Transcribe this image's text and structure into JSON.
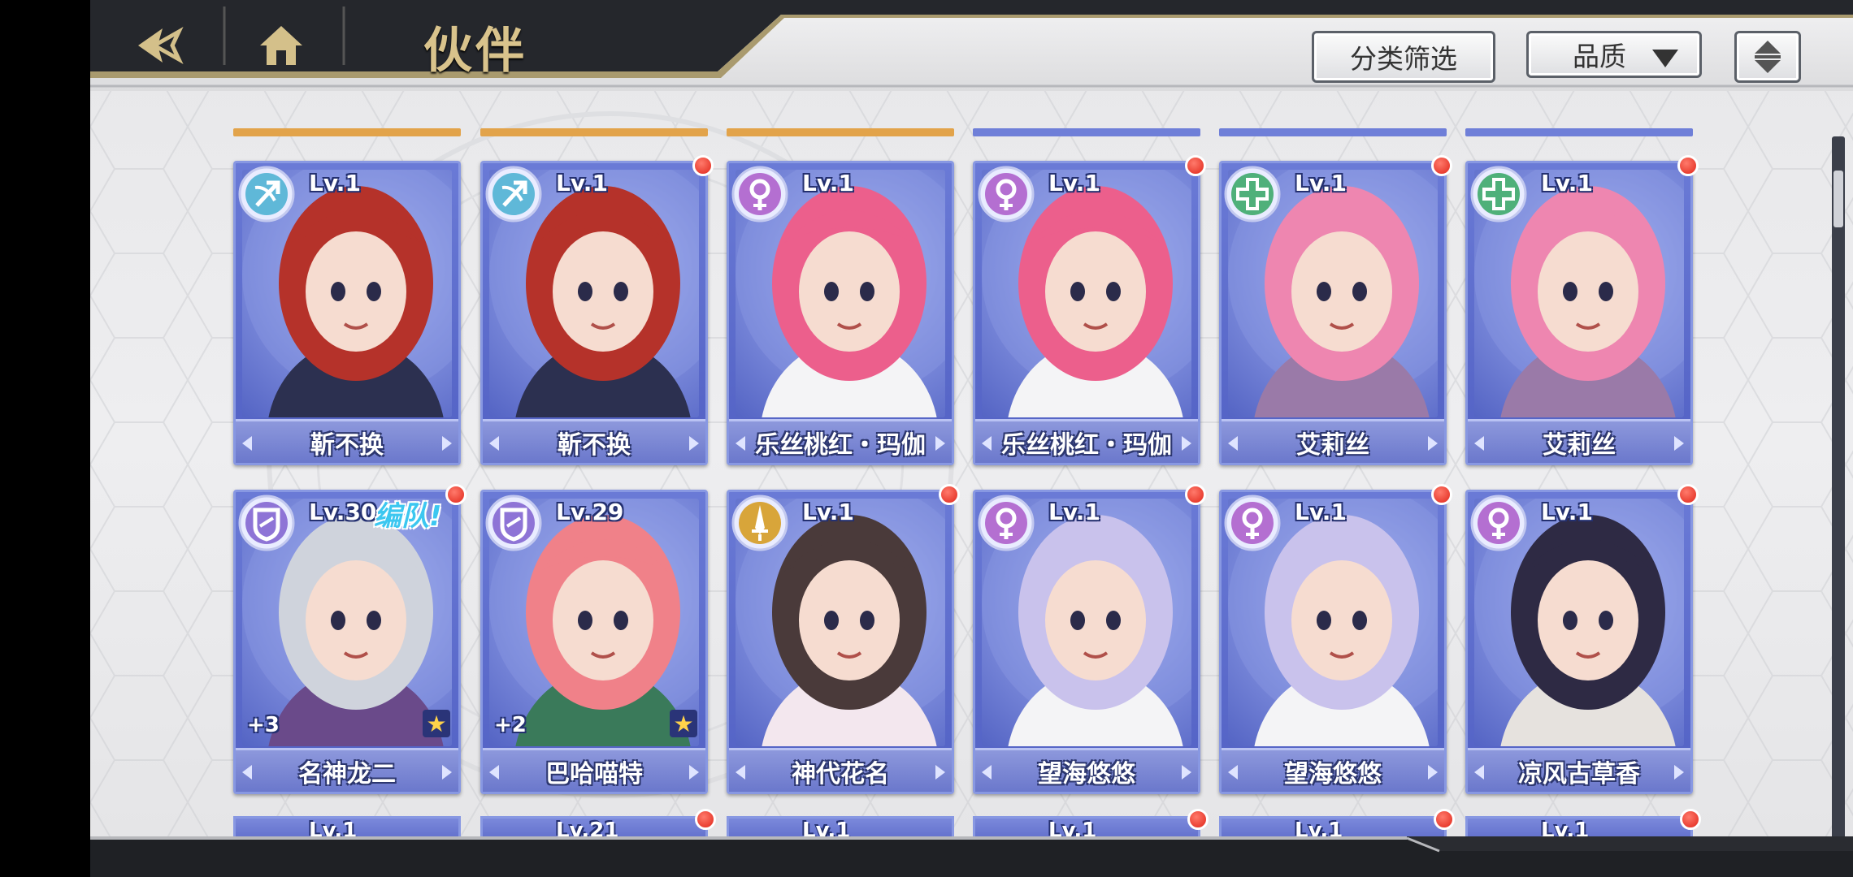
{
  "header": {
    "title": "伙伴",
    "back_icon": "back-arrow-icon",
    "home_icon": "home-icon",
    "filter_label": "分类筛选",
    "quality_label": "品质",
    "sort_icon": "sort-order-icon"
  },
  "colors": {
    "card_blue": "#6a7ad6",
    "red_dot": "#e0261a",
    "team_tag": "#3cc7f0",
    "title_gold": "#d9c38c"
  },
  "partners": [
    {
      "name": "靳不换",
      "level": "Lv.1",
      "class_icon": "bow-icon",
      "class_color": "#5fb8d8",
      "new": false
    },
    {
      "name": "靳不换",
      "level": "Lv.1",
      "class_icon": "bow-icon",
      "class_color": "#5fb8d8",
      "new": true
    },
    {
      "name": "乐丝桃红・玛伽",
      "level": "Lv.1",
      "class_icon": "staff-icon",
      "class_color": "#b46fd1",
      "new": false
    },
    {
      "name": "乐丝桃红・玛伽",
      "level": "Lv.1",
      "class_icon": "staff-icon",
      "class_color": "#b46fd1",
      "new": true
    },
    {
      "name": "艾莉丝",
      "level": "Lv.1",
      "class_icon": "heal-cross-icon",
      "class_color": "#4fb07a",
      "new": true
    },
    {
      "name": "艾莉丝",
      "level": "Lv.1",
      "class_icon": "heal-cross-icon",
      "class_color": "#4fb07a",
      "new": true
    },
    {
      "name": "名神龙二",
      "level": "Lv.30",
      "team_tag": "编队!",
      "plus": "+3",
      "starred": true,
      "class_icon": "shield-icon",
      "class_color": "#8e74d6",
      "new": true
    },
    {
      "name": "巴哈喵特",
      "level": "Lv.29",
      "plus": "+2",
      "starred": true,
      "class_icon": "shield-icon",
      "class_color": "#8e74d6",
      "new": false
    },
    {
      "name": "神代花名",
      "level": "Lv.1",
      "class_icon": "sword-icon",
      "class_color": "#d8a53a",
      "new": true
    },
    {
      "name": "望海悠悠",
      "level": "Lv.1",
      "class_icon": "staff-icon",
      "class_color": "#b46fd1",
      "new": true
    },
    {
      "name": "望海悠悠",
      "level": "Lv.1",
      "class_icon": "staff-icon",
      "class_color": "#b46fd1",
      "new": true
    },
    {
      "name": "凉风古草香",
      "level": "Lv.1",
      "class_icon": "staff-icon",
      "class_color": "#b46fd1",
      "new": true
    }
  ],
  "next_row_levels": [
    "Lv.1",
    "Lv.21",
    "Lv.1",
    "Lv.1",
    "Lv.1",
    "Lv.1"
  ]
}
